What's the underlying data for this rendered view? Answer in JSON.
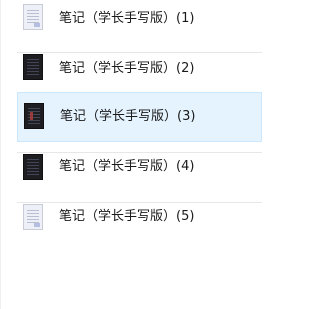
{
  "files": [
    {
      "name": "笔记（学长手写版）(1)",
      "thumbnail": "light-document-thumbnail",
      "selected": false
    },
    {
      "name": "笔记（学长手写版）(2)",
      "thumbnail": "dark-document-thumbnail",
      "selected": false
    },
    {
      "name": "笔记（学长手写版）(3)",
      "thumbnail": "dark-document-thumbnail",
      "selected": true
    },
    {
      "name": "笔记（学长手写版）(4)",
      "thumbnail": "dark-document-thumbnail",
      "selected": false
    },
    {
      "name": "笔记（学长手写版）(5)",
      "thumbnail": "light-document-thumbnail",
      "selected": false
    }
  ],
  "colors": {
    "selection_background": "#e5f3ff",
    "selection_border": "#cce8ff",
    "separator": "#e7e7e7",
    "text": "#1a1a1a"
  }
}
